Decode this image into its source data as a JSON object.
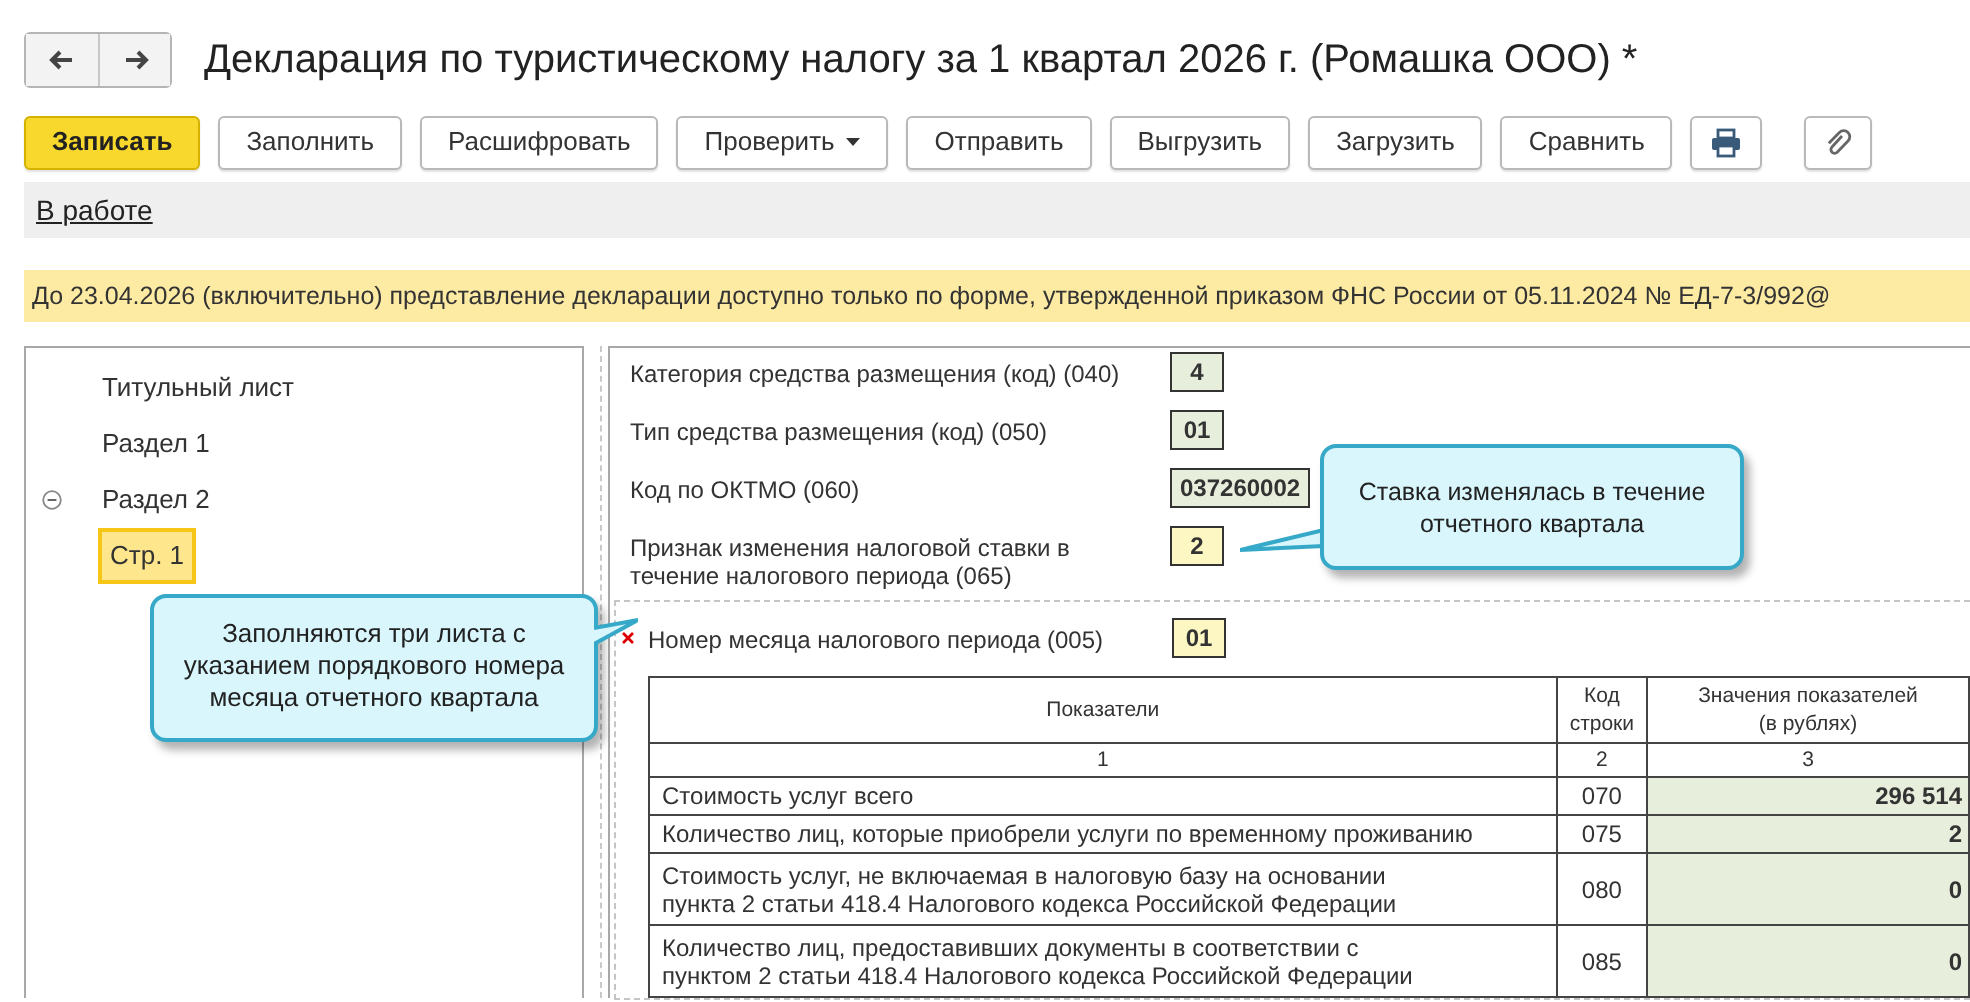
{
  "window": {
    "title": "Декларация по туристическому налогу за 1 квартал 2026 г. (Ромашка ООО) *"
  },
  "toolbar": [
    {
      "label": "Записать",
      "kind": "primary"
    },
    {
      "label": "Заполнить",
      "kind": "plain"
    },
    {
      "label": "Расшифровать",
      "kind": "plain"
    },
    {
      "label": "Проверить",
      "kind": "dropdown"
    },
    {
      "label": "Отправить",
      "kind": "plain"
    },
    {
      "label": "Выгрузить",
      "kind": "plain"
    },
    {
      "label": "Загрузить",
      "kind": "plain"
    },
    {
      "label": "Сравнить",
      "kind": "plain"
    },
    {
      "kind": "print"
    },
    {
      "kind": "attach"
    }
  ],
  "status_link": "В работе",
  "notice": "До 23.04.2026 (включительно) представление декларации доступно только по форме, утвержденной приказом ФНС России от 05.11.2024 № ЕД-7-3/992@",
  "tree": [
    {
      "label": "Титульный лист",
      "selected": false
    },
    {
      "label": "Раздел 1",
      "selected": false
    },
    {
      "label": "Раздел 2",
      "selected": false,
      "expanded": true,
      "children": [
        {
          "label": "Стр. 1",
          "selected": true
        }
      ]
    }
  ],
  "fields": [
    {
      "label": "Категория средства размещения (код) (040)",
      "value": "4",
      "editable": false
    },
    {
      "label": "Тип средства размещения (код) (050)",
      "value": "01",
      "editable": false
    },
    {
      "label": "Код по ОКТМО (060)",
      "value": "037260002",
      "editable": false
    },
    {
      "label": "Признак изменения налоговой ставки в\nтечение налогового периода  (065)",
      "value": "2",
      "editable": true
    }
  ],
  "month_field": {
    "label": "Номер месяца налогового периода (005)",
    "value": "01",
    "editable": true,
    "required": true
  },
  "table": {
    "columns": [
      "Показатели",
      "Код строки",
      "Значения показателей\n(в рублях)"
    ],
    "numbers": [
      "1",
      "2",
      "3"
    ],
    "rows": [
      {
        "name": "Стоимость услуг всего",
        "code": "070",
        "value": "296 514"
      },
      {
        "name": "Количество лиц, которые приобрели услуги по временному проживанию",
        "code": "075",
        "value": "2"
      },
      {
        "name": "Стоимость услуг, не включаемая в налоговую базу на основании\nпункта 2 статьи 418.4 Налогового кодекса Российской Федерации",
        "code": "080",
        "value": "0"
      },
      {
        "name": "Количество лиц, предоставивших документы в соответствии с\nпунктом 2 статьи 418.4 Налогового кодекса Российской Федерации",
        "code": "085",
        "value": "0"
      }
    ]
  },
  "callouts": [
    {
      "text": "Заполняются три листа с указанием порядкового номера месяца отчетного квартала",
      "kind": "right"
    },
    {
      "text": "Ставка изменялась в течение отчетного квартала",
      "kind": "left"
    }
  ]
}
